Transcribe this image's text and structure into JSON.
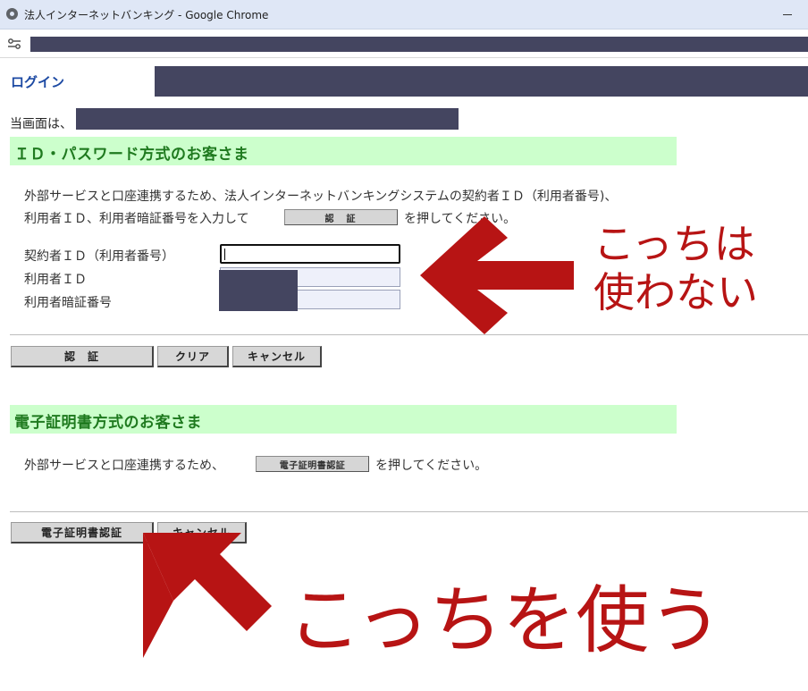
{
  "window": {
    "title": "法人インターネットバンキング - Google Chrome",
    "icon": "chrome-icon"
  },
  "page": {
    "login_heading": "ログイン",
    "intro_prefix": "当画面は、"
  },
  "id_section": {
    "title": "ＩＤ・パスワード方式のお客さま",
    "description_line1": "外部サービスと口座連携するため、法人インターネットバンキングシステムの契約者ＩＤ（利用者番号)、",
    "description_line2_prefix": "利用者ＩＤ、利用者暗証番号を入力して",
    "inline_button_label": "認　証",
    "description_line2_suffix": "を押してください。",
    "fields": [
      {
        "label": "契約者ＩＤ（利用者番号）",
        "value": ""
      },
      {
        "label": "利用者ＩＤ",
        "value": ""
      },
      {
        "label": "利用者暗証番号",
        "value": ""
      }
    ],
    "buttons": {
      "auth": "認　証",
      "clear": "クリア",
      "cancel": "キャンセル"
    }
  },
  "cert_section": {
    "title": "電子証明書方式のお客さま",
    "description_prefix": "外部サービスと口座連携するため、",
    "inline_button_label": "電子証明書認証",
    "description_suffix": "を押してください。",
    "buttons": {
      "cert_auth": "電子証明書認証",
      "cancel": "キャンセル"
    }
  },
  "annotations": {
    "top_line1": "こっちは",
    "top_line2": "使わない",
    "bottom": "こっちを使う",
    "color": "#b71414"
  }
}
